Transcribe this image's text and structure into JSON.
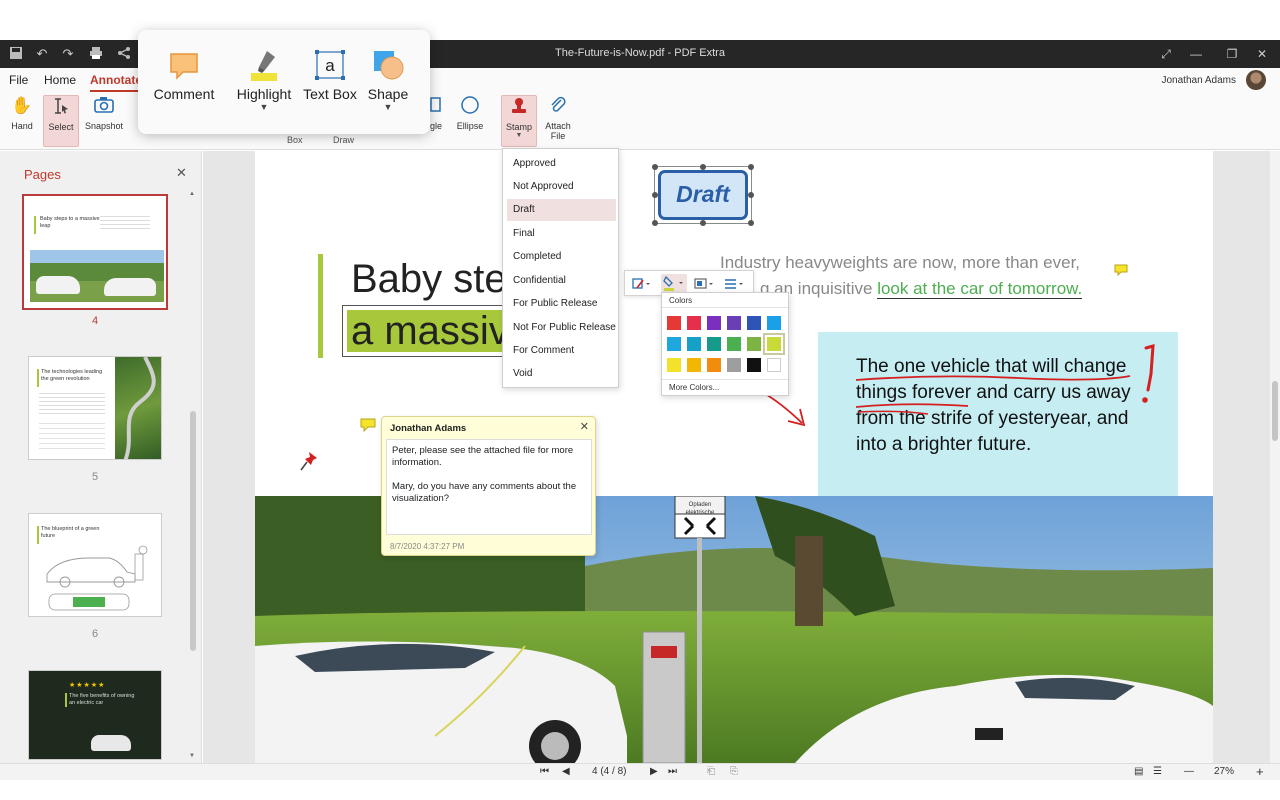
{
  "window": {
    "title": "The-Future-is-Now.pdf - PDF Extra"
  },
  "menu": {
    "file": "File",
    "home": "Home",
    "annotate": "Annotate"
  },
  "user": {
    "name": "Jonathan Adams"
  },
  "ribbon": {
    "hand": "Hand",
    "select": "Select",
    "snapshot": "Snapshot",
    "box": "Box",
    "draw": "Draw",
    "rectangle_partial": "angle",
    "ellipse": "Ellipse",
    "stamp": "Stamp",
    "attach_file": "Attach File"
  },
  "annotate_popup": {
    "comment": "Comment",
    "highlight": "Highlight",
    "text_box": "Text Box",
    "shape": "Shape"
  },
  "sidebar": {
    "title": "Pages",
    "pages": [
      {
        "number": "4",
        "heading": "Baby steps to a massive leap"
      },
      {
        "number": "5",
        "heading": "The technologies leading the green revolution"
      },
      {
        "number": "6",
        "heading": "The blueprint of a green future"
      },
      {
        "number": "",
        "heading": "The five benefits of owning an electric car"
      }
    ]
  },
  "stamp_menu": {
    "items": [
      "Approved",
      "Not Approved",
      "Draft",
      "Final",
      "Completed",
      "Confidential",
      "For Public Release",
      "Not For Public Release",
      "For Comment",
      "Void"
    ],
    "highlighted": "Draft"
  },
  "color_picker": {
    "title": "Colors",
    "more": "More Colors...",
    "swatches": [
      "#e53935",
      "#e4304a",
      "#7b2fbf",
      "#6a3fb5",
      "#2e54b8",
      "#1aa0e6",
      "#1ea8df",
      "#16a0c8",
      "#169a8a",
      "#4caf50",
      "#7cb342",
      "#c8d93a",
      "#f3e22a",
      "#f2b705",
      "#f28c0f",
      "#9e9e9e",
      "#111111",
      "#ffffff"
    ],
    "selected_index": 11
  },
  "document": {
    "stamp_label": "Draft",
    "heading_line1": "Baby ste",
    "heading_line2": "a massiv",
    "intro_line1": "Industry heavyweights are now, more than ever,",
    "intro_line2_prefix": "g an inquisitive ",
    "intro_link": "look at the car of tomorrow.",
    "quote_line1": "The one vehicle that will change",
    "quote_line2a": "things forever",
    "quote_line2b": " and carry us away",
    "quote_line3": "from the strife of yesteryear, and",
    "quote_line4": "into a brighter future.",
    "sign_line1": "Opladen",
    "sign_line2": "elektrische",
    "sign_line3": "voertuigen"
  },
  "comment": {
    "author": "Jonathan Adams",
    "body": "Peter, please see the attached file for more information.\n\nMary, do you have any comments about the visualization?",
    "timestamp": "8/7/2020 4:37:27 PM"
  },
  "status": {
    "page_indicator": "4 (4 / 8)",
    "zoom": "27%"
  },
  "colors": {
    "accent": "#c0392b",
    "lime": "#a6c83a",
    "quote_bg": "#c5edf2"
  }
}
